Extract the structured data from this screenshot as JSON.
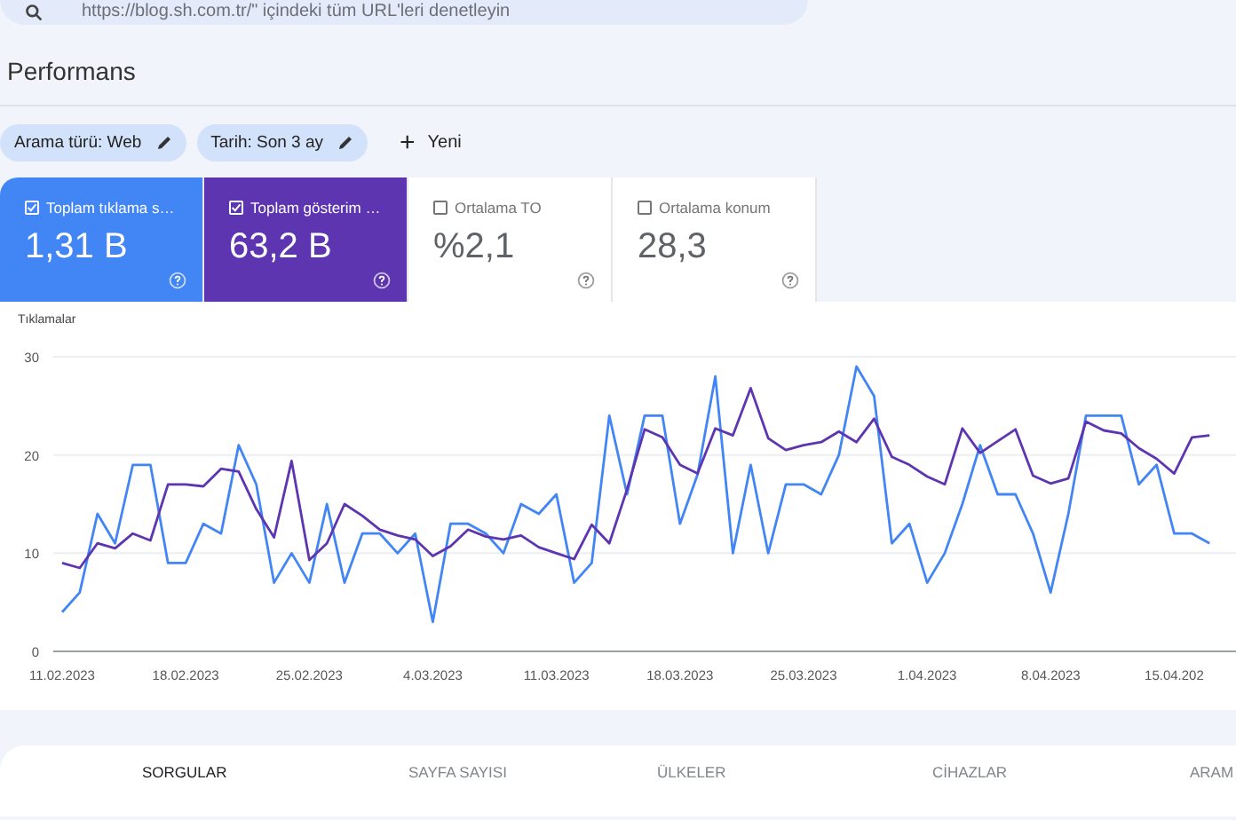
{
  "search": {
    "value": "https://blog.sh.com.tr/\" içindeki tüm URL'leri denetleyin"
  },
  "title": "Performans",
  "filters": [
    {
      "label": "Arama türü: Web"
    },
    {
      "label": "Tarih: Son 3 ay"
    }
  ],
  "new_filter": {
    "icon": "+",
    "label": "Yeni"
  },
  "metrics": [
    {
      "label": "Toplam tıklama s…",
      "value": "1,31 B",
      "checked": true,
      "color": "#4285f4"
    },
    {
      "label": "Toplam gösterim …",
      "value": "63,2 B",
      "checked": true,
      "color": "#5e35b1"
    },
    {
      "label": "Ortalama TO",
      "value": "%2,1",
      "checked": false
    },
    {
      "label": "Ortalama konum",
      "value": "28,3",
      "checked": false
    }
  ],
  "chart": {
    "chart_data": {
      "type": "line",
      "ylabel": "Tıklamalar",
      "categories": [
        "11.02.2023",
        null,
        null,
        null,
        null,
        null,
        null,
        "18.02.2023",
        null,
        null,
        null,
        null,
        null,
        null,
        "25.02.2023",
        null,
        null,
        null,
        null,
        null,
        null,
        "4.03.2023",
        null,
        null,
        null,
        null,
        null,
        null,
        "11.03.2023",
        null,
        null,
        null,
        null,
        null,
        null,
        "18.03.2023",
        null,
        null,
        null,
        null,
        null,
        null,
        "25.03.2023",
        null,
        null,
        null,
        null,
        null,
        null,
        "1.04.2023",
        null,
        null,
        null,
        null,
        null,
        null,
        "8.04.2023",
        null,
        null,
        null,
        null,
        null,
        null,
        "15.04.202",
        null,
        null
      ],
      "ylim": [
        0,
        30
      ],
      "yticks": [
        0,
        10,
        20,
        30
      ],
      "series": [
        {
          "color": "#4285f4",
          "values": [
            4,
            6,
            14,
            11,
            19,
            19,
            9,
            9,
            13,
            12,
            21,
            17,
            7,
            10,
            7,
            15,
            7,
            12,
            12,
            10,
            12,
            3,
            13,
            13,
            12,
            10,
            15,
            14,
            16,
            7,
            9,
            24,
            16,
            24,
            24,
            13,
            18,
            28,
            10,
            19,
            10,
            17,
            17,
            16,
            20,
            29,
            26,
            11,
            13,
            7,
            10,
            15,
            21,
            16,
            16,
            12,
            6,
            14,
            24,
            24,
            24,
            17,
            19,
            12,
            12,
            11
          ]
        },
        {
          "color": "#5e35b1",
          "values": [
            9,
            8.5,
            11,
            10.5,
            12,
            11.3,
            17,
            17,
            16.8,
            18.6,
            18.3,
            14.5,
            11.6,
            19.4,
            9.3,
            11,
            15,
            13.8,
            12.4,
            11.8,
            11.4,
            9.7,
            10.7,
            12.4,
            11.7,
            11.4,
            11.8,
            10.6,
            10,
            9.4,
            12.9,
            11,
            16.5,
            22.6,
            21.8,
            19,
            18.1,
            22.7,
            22,
            26.8,
            21.7,
            20.5,
            21,
            21.3,
            22.4,
            21.3,
            23.7,
            19.8,
            19,
            17.8,
            17,
            22.7,
            20.2,
            21.4,
            22.6,
            17.9,
            17.1,
            17.6,
            23.4,
            22.5,
            22.2,
            20.7,
            19.6,
            18.1,
            21.8,
            22
          ]
        }
      ]
    }
  },
  "tabs": [
    {
      "label": "SORGULAR",
      "selected": true
    },
    {
      "label": "SAYFA SAYISI",
      "selected": false
    },
    {
      "label": "ÜLKELER",
      "selected": false
    },
    {
      "label": "CİHAZLAR",
      "selected": false
    },
    {
      "label": "ARAM",
      "selected": false
    }
  ]
}
